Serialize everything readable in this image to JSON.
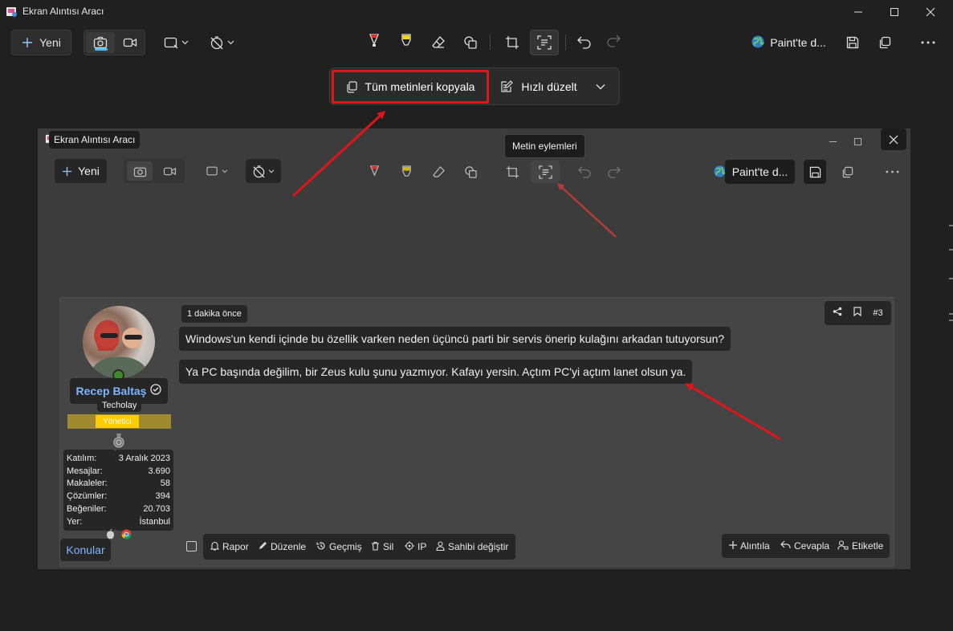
{
  "app": {
    "title": "Ekran Alıntısı Aracı"
  },
  "toolbar": {
    "new_label": "Yeni",
    "paint_label": "Paint'te d..."
  },
  "text_actions": {
    "copy_all_label": "Tüm metinleri kopyala",
    "quick_fix_label": "Hızlı düzelt"
  },
  "inner": {
    "title": "Ekran Alıntısı Aracı",
    "new_label": "Yeni",
    "tooltip": "Metin eylemleri",
    "paint_label": "Paint'te d..."
  },
  "post": {
    "time": "1 dakika önce",
    "number": "#3",
    "lines": [
      "Windows'un kendi içinde bu özellik varken neden üçüncü parti bir servis önerip kulağını arkadan tutuyorsun?",
      "Ya PC başında değilim, bir Zeus kulu şunu yazmıyor. Kafayı yersin. Açtım PC'yi açtım lanet olsun ya."
    ],
    "actions_left": [
      "Rapor",
      "Düzenle",
      "Geçmiş",
      "Sil",
      "IP",
      "Sahibi değiştir"
    ],
    "actions_right": [
      "Alıntıla",
      "Cevapla",
      "Etiketle"
    ]
  },
  "user": {
    "name": "Recep Baltaş",
    "subtitle": "Techolay",
    "role": "Yönetici",
    "stats": [
      {
        "label": "Katılım:",
        "value": "3 Aralık 2023"
      },
      {
        "label": "Mesajlar:",
        "value": "3.690"
      },
      {
        "label": "Makaleler:",
        "value": "58"
      },
      {
        "label": "Çözümler:",
        "value": "394"
      },
      {
        "label": "Beğeniler:",
        "value": "20.703"
      },
      {
        "label": "Yer:",
        "value": "İstanbul"
      }
    ],
    "topics_label": "Konular"
  },
  "colors": {
    "accent": "#4cc2ff",
    "highlight_box": "#e0151b",
    "arrow": "#e0151b",
    "role_badge": "#ffcc00",
    "username": "#7fb4ff"
  }
}
